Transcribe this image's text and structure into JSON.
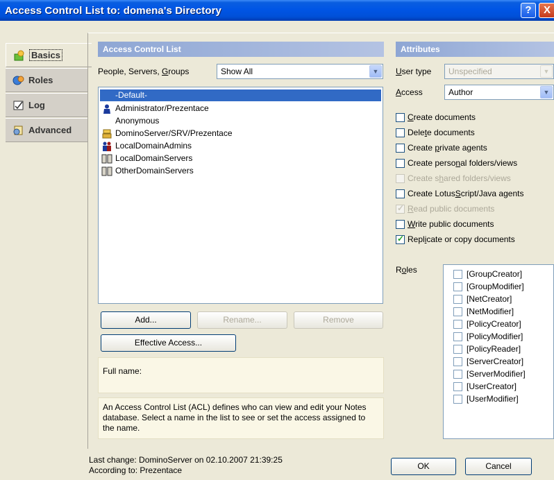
{
  "window": {
    "title": "Access Control List to: domena's Directory",
    "help_label": "?",
    "close_label": "X"
  },
  "tabs": [
    {
      "label": "Basics",
      "icon": "basics-icon",
      "active": true
    },
    {
      "label": "Roles",
      "icon": "roles-icon",
      "active": false
    },
    {
      "label": "Log",
      "icon": "log-icon",
      "active": false
    },
    {
      "label": "Advanced",
      "icon": "advanced-icon",
      "active": false
    }
  ],
  "acl": {
    "header": "Access Control List",
    "filter_label": "People, Servers, Groups",
    "filter_value": "Show All",
    "entries": [
      {
        "name": "-Default-",
        "icon": "none",
        "selected": true
      },
      {
        "name": "Administrator/Prezentace",
        "icon": "person-icon"
      },
      {
        "name": "Anonymous",
        "icon": "none"
      },
      {
        "name": "DominoServer/SRV/Prezentace",
        "icon": "server-icon"
      },
      {
        "name": "LocalDomainAdmins",
        "icon": "group-icon"
      },
      {
        "name": "LocalDomainServers",
        "icon": "server-group-icon"
      },
      {
        "name": "OtherDomainServers",
        "icon": "server-group-icon"
      }
    ],
    "add_label": "Add...",
    "rename_label": "Rename...",
    "remove_label": "Remove",
    "effective_access_label": "Effective Access...",
    "full_name_label": "Full name:",
    "description": "An Access Control List (ACL) defines who can view and edit your Notes database.  Select a name in the list to see or set the access assigned to the name."
  },
  "attributes": {
    "header": "Attributes",
    "user_type_label": "User type",
    "user_type_value": "Unspecified",
    "access_label": "Access",
    "access_value": "Author",
    "checkboxes": [
      {
        "label": "Create documents",
        "checked": false,
        "disabled": false
      },
      {
        "label": "Delete documents",
        "checked": false,
        "disabled": false
      },
      {
        "label": "Create private agents",
        "checked": false,
        "disabled": false
      },
      {
        "label": "Create personal folders/views",
        "checked": false,
        "disabled": false
      },
      {
        "label": "Create shared folders/views",
        "checked": false,
        "disabled": true
      },
      {
        "label": "Create LotusScript/Java agents",
        "checked": false,
        "disabled": false
      },
      {
        "label": "Read public documents",
        "checked": true,
        "disabled": true
      },
      {
        "label": "Write public documents",
        "checked": false,
        "disabled": false
      },
      {
        "label": "Replicate or copy documents",
        "checked": true,
        "disabled": false
      }
    ],
    "roles_label": "Roles",
    "roles": [
      "[GroupCreator]",
      "[GroupModifier]",
      "[NetCreator]",
      "[NetModifier]",
      "[PolicyCreator]",
      "[PolicyModifier]",
      "[PolicyReader]",
      "[ServerCreator]",
      "[ServerModifier]",
      "[UserCreator]",
      "[UserModifier]"
    ]
  },
  "footer": {
    "last_change": "Last change: DominoServer on 02.10.2007 21:39:25",
    "according_to": "According to: Prezentace",
    "ok_label": "OK",
    "cancel_label": "Cancel"
  }
}
